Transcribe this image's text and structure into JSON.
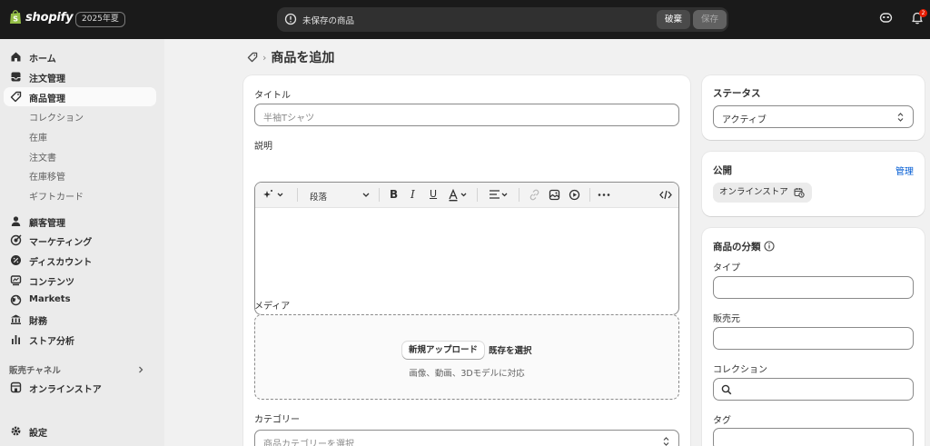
{
  "topbar": {
    "brand": "shopify",
    "edition": "2025年夏",
    "unsaved_text": "未保存の商品",
    "discard_label": "破棄",
    "save_label": "保存",
    "notification_count": "2"
  },
  "sidebar": {
    "items": [
      {
        "label": "ホーム",
        "icon": "home-icon"
      },
      {
        "label": "注文管理",
        "icon": "inbox-icon"
      },
      {
        "label": "商品管理",
        "icon": "tag-icon",
        "active": true
      }
    ],
    "sub_items": [
      "コレクション",
      "在庫",
      "注文書",
      "在庫移管",
      "ギフトカード"
    ],
    "items2": [
      {
        "label": "顧客管理",
        "icon": "person-icon"
      },
      {
        "label": "マーケティング",
        "icon": "target-icon"
      },
      {
        "label": "ディスカウント",
        "icon": "discount-icon"
      },
      {
        "label": "コンテンツ",
        "icon": "content-icon"
      },
      {
        "label": "Markets",
        "icon": "globe-icon"
      },
      {
        "label": "財務",
        "icon": "bank-icon"
      },
      {
        "label": "ストア分析",
        "icon": "chart-icon"
      }
    ],
    "sales_channels_title": "販売チャネル",
    "online_store_label": "オンラインストア",
    "settings_label": "設定"
  },
  "page": {
    "title": "商品を追加"
  },
  "product_form": {
    "title_label": "タイトル",
    "title_placeholder": "半袖Tシャツ",
    "description_label": "説明",
    "paragraph_label": "段落",
    "media_label": "メディア",
    "upload_new_label": "新規アップロード",
    "select_existing_label": "既存を選択",
    "media_hint": "画像、動画、3Dモデルに対応",
    "category_label": "カテゴリー",
    "category_placeholder": "商品カテゴリーを選択"
  },
  "status_card": {
    "title": "ステータス",
    "value": "アクティブ"
  },
  "publishing_card": {
    "title": "公開",
    "manage_label": "管理",
    "channel": "オンラインストア"
  },
  "organization_card": {
    "title": "商品の分類",
    "type_label": "タイプ",
    "vendor_label": "販売元",
    "collections_label": "コレクション",
    "tags_label": "タグ"
  },
  "colors": {
    "topbar": "#1a1a1a",
    "accent_link": "#005bd3",
    "badge": "#e51c00"
  }
}
